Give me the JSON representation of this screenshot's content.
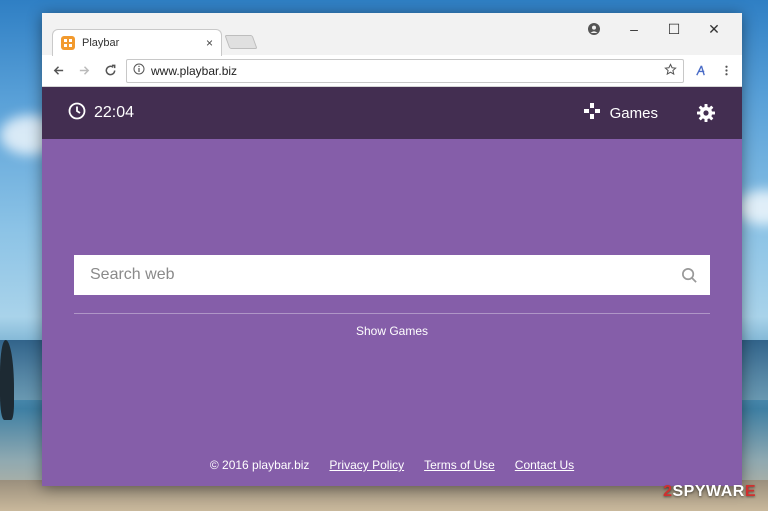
{
  "browser": {
    "tab_title": "Playbar",
    "tab_close": "×",
    "url": "www.playbar.biz",
    "window_controls": {
      "minimize": "–",
      "maximize": "☐",
      "close": "✕"
    }
  },
  "page": {
    "clock_time": "22:04",
    "games_label": "Games",
    "search_placeholder": "Search web",
    "show_games_label": "Show Games",
    "footer": {
      "copyright": "© 2016 playbar.biz",
      "privacy": "Privacy Policy",
      "terms": "Terms of Use",
      "contact": "Contact Us"
    }
  },
  "watermark": {
    "digit": "2",
    "text": "SPYWAR",
    "accent": "E"
  },
  "colors": {
    "header_bg": "#432e51",
    "page_bg": "#855ea9",
    "tab_icon": "#f29a2e",
    "watermark_accent": "#d0302f"
  },
  "icons": [
    "playbar-logo-icon",
    "back-arrow-icon",
    "forward-arrow-icon",
    "reload-icon",
    "info-icon",
    "star-icon",
    "extension-icon",
    "menu-dots-icon",
    "clock-icon",
    "gamepad-icon",
    "gear-icon",
    "search-icon",
    "profile-icon"
  ]
}
